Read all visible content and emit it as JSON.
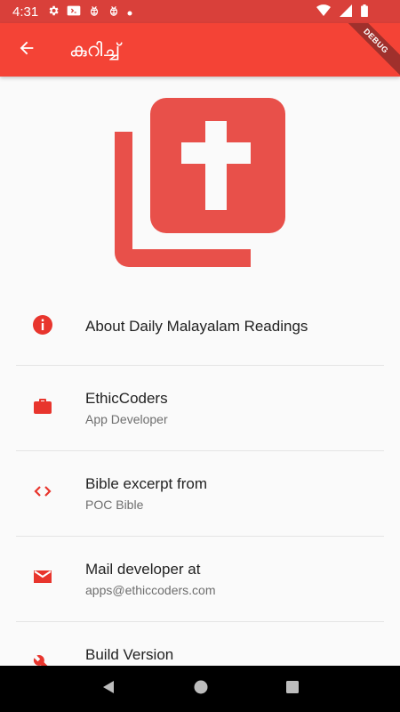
{
  "status_bar": {
    "time": "4:31",
    "icons": [
      "settings-icon",
      "media-icon",
      "bug-icon",
      "bug-icon",
      "dot-icon",
      "wifi-icon",
      "signal-icon",
      "battery-icon"
    ]
  },
  "debug_banner": "DEBUG",
  "app_bar": {
    "title": "കുറിച്ച്",
    "back_icon": "arrow-back-icon"
  },
  "colors": {
    "primary": "#f44336",
    "status_bar": "#d9403a",
    "logo": "#e8504a"
  },
  "list": [
    {
      "icon": "info-icon",
      "title": "About Daily Malayalam Readings",
      "subtitle": ""
    },
    {
      "icon": "briefcase-icon",
      "title": "EthicCoders",
      "subtitle": "App Developer"
    },
    {
      "icon": "code-icon",
      "title": "Bible excerpt from",
      "subtitle": "POC Bible"
    },
    {
      "icon": "email-icon",
      "title": "Mail developer at",
      "subtitle": "apps@ethiccoders.com"
    },
    {
      "icon": "build-icon",
      "title": "Build Version",
      "subtitle": ""
    }
  ],
  "nav_bar": [
    "back-triangle-icon",
    "home-circle-icon",
    "recents-square-icon"
  ]
}
